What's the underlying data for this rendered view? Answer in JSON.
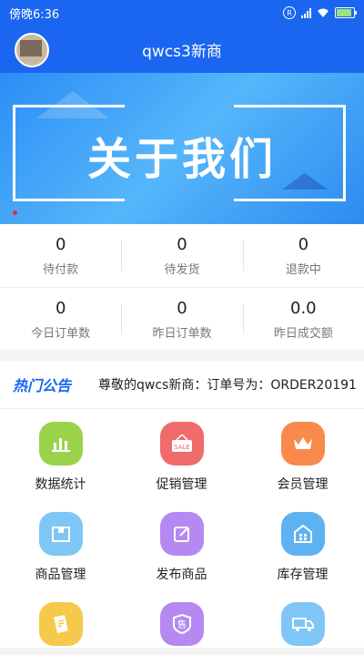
{
  "status_bar": {
    "time": "傍晚6:36",
    "r_badge": "R"
  },
  "header": {
    "title": "qwcs3新商"
  },
  "banner": {
    "title": "关于我们"
  },
  "stats": {
    "row1": [
      {
        "value": "0",
        "label": "待付款"
      },
      {
        "value": "0",
        "label": "待发货"
      },
      {
        "value": "0",
        "label": "退款中"
      }
    ],
    "row2": [
      {
        "value": "0",
        "label": "今日订单数"
      },
      {
        "value": "0",
        "label": "昨日订单数"
      },
      {
        "value": "0.0",
        "label": "昨日成交额"
      }
    ]
  },
  "notice": {
    "tag": "热门公告",
    "text": "尊敬的qwcs新商：订单号为：ORDER20191"
  },
  "menu": [
    {
      "label": "数据统计",
      "color": "#9ad24b",
      "icon": "bar-chart-icon"
    },
    {
      "label": "促销管理",
      "color": "#f06b6b",
      "icon": "sale-sign-icon",
      "icon_text": "SALE"
    },
    {
      "label": "会员管理",
      "color": "#f98a4b",
      "icon": "crown-icon"
    },
    {
      "label": "商品管理",
      "color": "#7ec6f6",
      "icon": "product-box-icon"
    },
    {
      "label": "发布商品",
      "color": "#b48af2",
      "icon": "edit-icon"
    },
    {
      "label": "库存管理",
      "color": "#5fb2f2",
      "icon": "warehouse-icon"
    },
    {
      "label": "",
      "color": "#f5c94b",
      "icon": "document-icon"
    },
    {
      "label": "",
      "color": "#b48af2",
      "icon": "shop-tag-icon",
      "icon_text": "售"
    },
    {
      "label": "",
      "color": "#7ec6f6",
      "icon": "truck-icon"
    }
  ]
}
